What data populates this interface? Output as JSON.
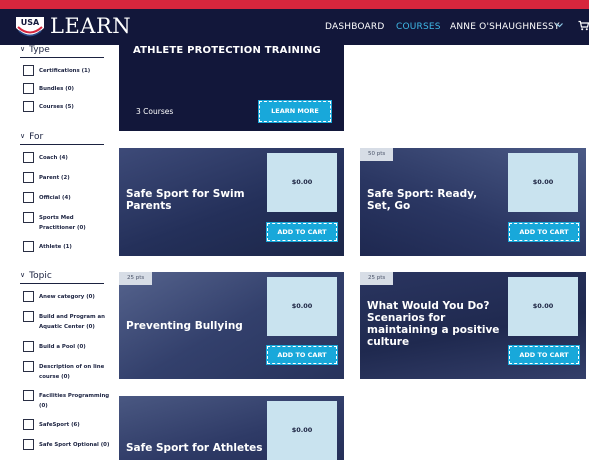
{
  "header": {
    "logo_text": "USA",
    "brand": "LEARN",
    "nav": {
      "dashboard": "DASHBOARD",
      "courses": "COURSES",
      "user": "ANNE O'SHAUGHNESSY"
    }
  },
  "sidebar": {
    "type": {
      "title": "Type",
      "items": [
        "Certifications (1)",
        "Bundles (0)",
        "Courses (5)"
      ]
    },
    "for": {
      "title": "For",
      "items": [
        "Coach (4)",
        "Parent (2)",
        "Official (4)",
        "Sports Med Practitioner (0)",
        "Athlete (1)"
      ]
    },
    "topic": {
      "title": "Topic",
      "items": [
        "Anew category (0)",
        "Build and Program an Aquatic Center (0)",
        "Build a Pool (0)",
        "Description of on line course (0)",
        "Facilities Programming (0)",
        "SafeSport (6)",
        "Safe Sport Optional (0)"
      ]
    }
  },
  "hero": {
    "title": "ATHLETE PROTECTION TRAINING",
    "count": "3 Courses",
    "button": "LEARN MORE"
  },
  "cards": [
    {
      "title": "Safe Sport for Swim Parents",
      "price": "$0.00",
      "button": "ADD TO CART",
      "pts": ""
    },
    {
      "title": "Safe Sport: Ready, Set, Go",
      "price": "$0.00",
      "button": "ADD TO CART",
      "pts": "50 pts"
    },
    {
      "title": "Preventing Bullying",
      "price": "$0.00",
      "button": "ADD TO CART",
      "pts": "25 pts"
    },
    {
      "title": "What Would You Do? Scenarios for maintaining a positive culture",
      "price": "$0.00",
      "button": "ADD TO CART",
      "pts": "25 pts"
    },
    {
      "title": "Safe Sport for Athletes",
      "price": "$0.00",
      "button": "",
      "pts": ""
    }
  ],
  "colors": {
    "navy": "#12173a",
    "accent_blue": "#18a8da",
    "red": "#d7263d",
    "price_bg": "#c9e3ef"
  },
  "icons": {
    "logo": "usa-swimming-shield-icon",
    "cart": "cart-icon",
    "chevron": "chevron-down-icon"
  }
}
